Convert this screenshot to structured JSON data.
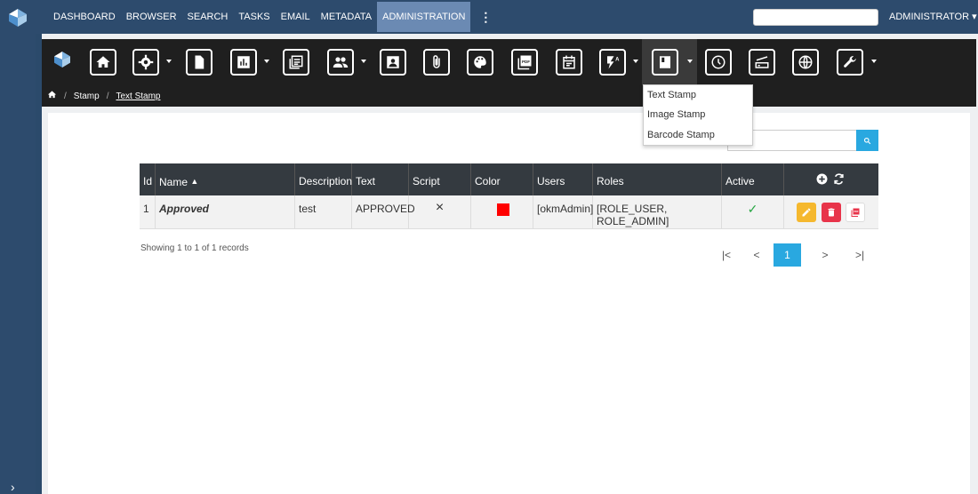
{
  "topnav": {
    "items": [
      "DASHBOARD",
      "BROWSER",
      "SEARCH",
      "TASKS",
      "EMAIL",
      "METADATA",
      "ADMINISTRATION"
    ],
    "active": "ADMINISTRATION",
    "more": "⋮",
    "user": "ADMINISTRATOR ▾"
  },
  "toolbar": {
    "icons": [
      "home-icon",
      "gear-icon",
      "document-icon",
      "report-icon",
      "news-icon",
      "users-icon",
      "user-icon",
      "attachment-icon",
      "palette-icon",
      "pdf-icon",
      "calendar-icon",
      "automation-icon",
      "stamp-icon",
      "clock-icon",
      "scanner-icon",
      "globe-icon",
      "wrench-icon"
    ]
  },
  "breadcrumb": {
    "items": [
      "Stamp",
      "Text Stamp"
    ]
  },
  "dropdown": {
    "items": [
      "Text Stamp",
      "Image Stamp",
      "Barcode Stamp"
    ]
  },
  "table": {
    "columns": [
      "Id",
      "Name",
      "Description",
      "Text",
      "Script",
      "Color",
      "Users",
      "Roles",
      "Active"
    ],
    "rows": [
      {
        "id": "1",
        "name": "Approved",
        "description": "test",
        "text": "APPROVED",
        "script": "×",
        "color": "#ff0000",
        "users": "[okmAdmin]",
        "roles": "[ROLE_USER, ROLE_ADMIN]",
        "active": "✓"
      }
    ]
  },
  "footer": {
    "showing": "Showing 1 to 1 of 1 records",
    "pagination": [
      "|<",
      "<",
      "1",
      ">",
      ">|"
    ],
    "current_page": "1"
  },
  "colors": {
    "accent": "#29a8e0",
    "edit": "#f5b82e",
    "delete": "#e8344a"
  }
}
